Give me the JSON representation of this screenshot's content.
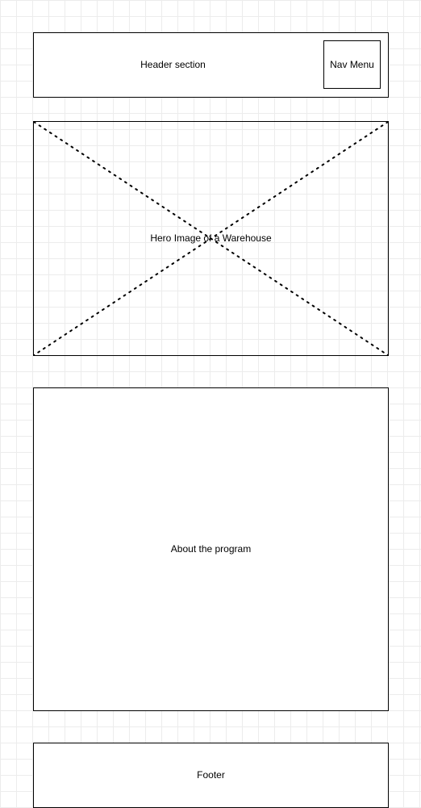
{
  "header": {
    "label": "Header section",
    "nav": {
      "label": "Nav Menu"
    }
  },
  "hero": {
    "label": "Hero Image of a Warehouse"
  },
  "about": {
    "label": "About the program"
  },
  "footer": {
    "label": "Footer"
  }
}
